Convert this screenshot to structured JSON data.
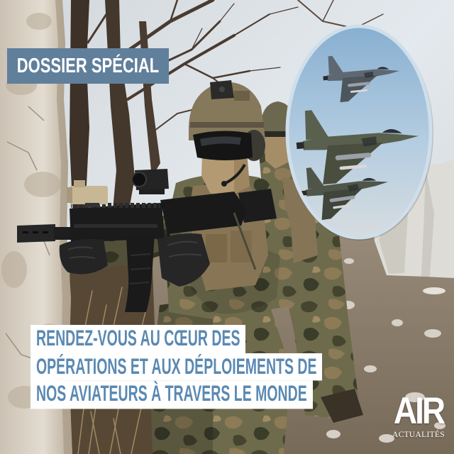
{
  "banner": {
    "label": "DOSSIER SPÉCIAL"
  },
  "headline": {
    "lines": [
      "RENDEZ-VOUS AU CŒUR DES",
      "OPÉRATIONS ET AUX DÉPLOIEMENTS DE",
      "NOS AVIATEURS À TRAVERS LE MONDE"
    ]
  },
  "logo": {
    "wordmark": "AIR",
    "tagline": "ACTUALITÉS"
  },
  "colors": {
    "banner_bg": "#607f9b",
    "headline_text": "#5a89b2",
    "headline_bg": "#ffffff",
    "inset_ring": "#cfdeeb",
    "logo": "#ffffff"
  }
}
